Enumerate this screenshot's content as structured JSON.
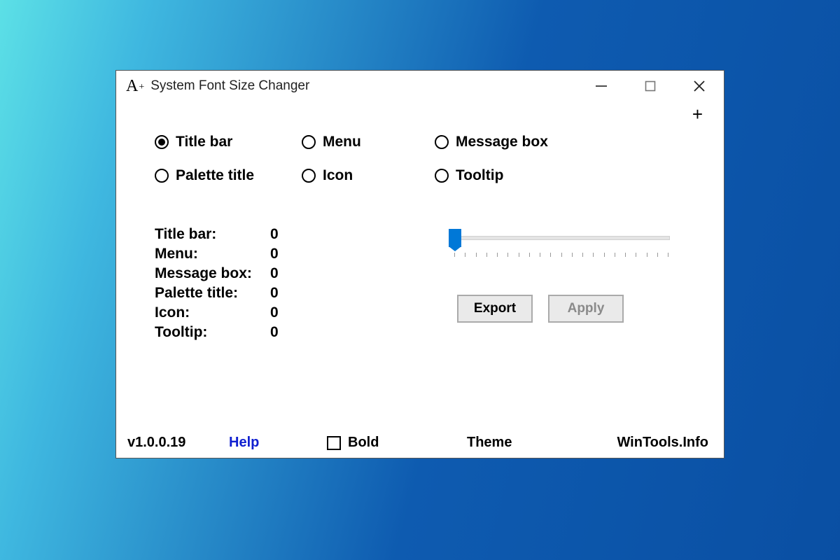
{
  "window": {
    "title": "System Font Size Changer"
  },
  "radios": {
    "title_bar": "Title bar",
    "menu": "Menu",
    "message_box": "Message box",
    "palette_title": "Palette title",
    "icon": "Icon",
    "tooltip": "Tooltip",
    "selected": "title_bar"
  },
  "values": {
    "title_bar": {
      "label": "Title bar:",
      "value": "0"
    },
    "menu": {
      "label": "Menu:",
      "value": "0"
    },
    "message_box": {
      "label": "Message box:",
      "value": "0"
    },
    "palette_title": {
      "label": "Palette title:",
      "value": "0"
    },
    "icon": {
      "label": "Icon:",
      "value": "0"
    },
    "tooltip": {
      "label": "Tooltip:",
      "value": "0"
    }
  },
  "buttons": {
    "export": "Export",
    "apply": "Apply"
  },
  "footer": {
    "version": "v1.0.0.19",
    "help": "Help",
    "bold": "Bold",
    "theme": "Theme",
    "site": "WinTools.Info"
  },
  "slider": {
    "value": 0,
    "min": 0,
    "max": 20
  },
  "bold_checked": false
}
